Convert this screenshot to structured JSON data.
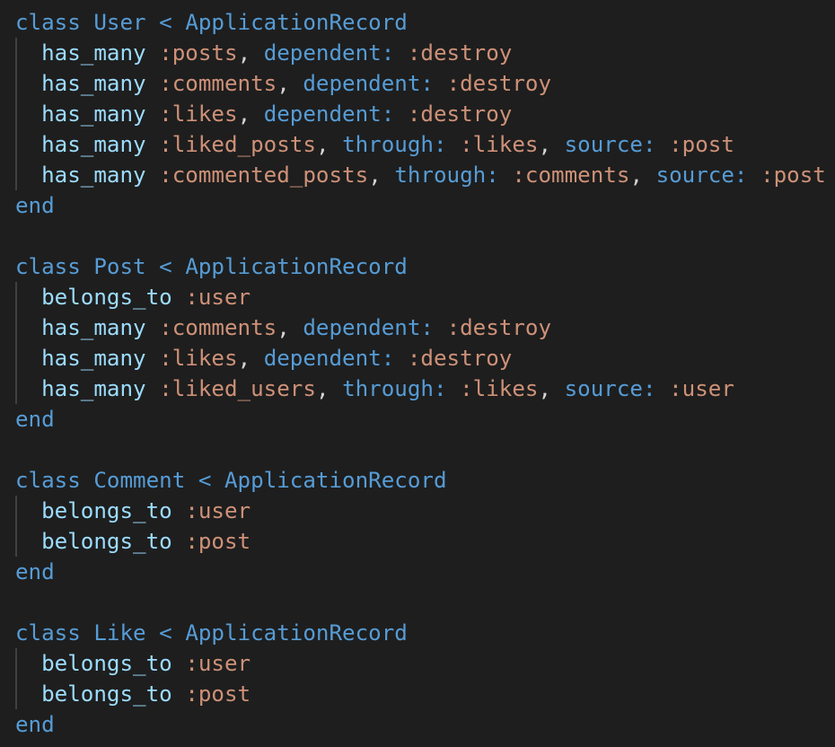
{
  "colors": {
    "background": "#1e1e1e",
    "keyword": "#569cd6",
    "constant": "#4ec9b0",
    "symbol": "#ce9178",
    "method": "#9cdcfe",
    "plain": "#d4d4d4",
    "indent_guide": "#404040"
  },
  "code": {
    "lines": [
      [
        {
          "t": "class",
          "c": "keyword"
        },
        {
          "t": " ",
          "c": "plain"
        },
        {
          "t": "User",
          "c": "keyword"
        },
        {
          "t": " < ",
          "c": "keyword"
        },
        {
          "t": "ApplicationRecord",
          "c": "keyword"
        }
      ],
      [
        {
          "t": "  ",
          "c": "plain"
        },
        {
          "t": "has_many",
          "c": "method"
        },
        {
          "t": " ",
          "c": "plain"
        },
        {
          "t": ":posts",
          "c": "symbol"
        },
        {
          "t": ", ",
          "c": "plain"
        },
        {
          "t": "dependent:",
          "c": "keyword"
        },
        {
          "t": " ",
          "c": "plain"
        },
        {
          "t": ":destroy",
          "c": "symbol"
        }
      ],
      [
        {
          "t": "  ",
          "c": "plain"
        },
        {
          "t": "has_many",
          "c": "method"
        },
        {
          "t": " ",
          "c": "plain"
        },
        {
          "t": ":comments",
          "c": "symbol"
        },
        {
          "t": ", ",
          "c": "plain"
        },
        {
          "t": "dependent:",
          "c": "keyword"
        },
        {
          "t": " ",
          "c": "plain"
        },
        {
          "t": ":destroy",
          "c": "symbol"
        }
      ],
      [
        {
          "t": "  ",
          "c": "plain"
        },
        {
          "t": "has_many",
          "c": "method"
        },
        {
          "t": " ",
          "c": "plain"
        },
        {
          "t": ":likes",
          "c": "symbol"
        },
        {
          "t": ", ",
          "c": "plain"
        },
        {
          "t": "dependent:",
          "c": "keyword"
        },
        {
          "t": " ",
          "c": "plain"
        },
        {
          "t": ":destroy",
          "c": "symbol"
        }
      ],
      [
        {
          "t": "  ",
          "c": "plain"
        },
        {
          "t": "has_many",
          "c": "method"
        },
        {
          "t": " ",
          "c": "plain"
        },
        {
          "t": ":liked_posts",
          "c": "symbol"
        },
        {
          "t": ", ",
          "c": "plain"
        },
        {
          "t": "through:",
          "c": "keyword"
        },
        {
          "t": " ",
          "c": "plain"
        },
        {
          "t": ":likes",
          "c": "symbol"
        },
        {
          "t": ", ",
          "c": "plain"
        },
        {
          "t": "source:",
          "c": "keyword"
        },
        {
          "t": " ",
          "c": "plain"
        },
        {
          "t": ":post",
          "c": "symbol"
        }
      ],
      [
        {
          "t": "  ",
          "c": "plain"
        },
        {
          "t": "has_many",
          "c": "method"
        },
        {
          "t": " ",
          "c": "plain"
        },
        {
          "t": ":commented_posts",
          "c": "symbol"
        },
        {
          "t": ", ",
          "c": "plain"
        },
        {
          "t": "through:",
          "c": "keyword"
        },
        {
          "t": " ",
          "c": "plain"
        },
        {
          "t": ":comments",
          "c": "symbol"
        },
        {
          "t": ", ",
          "c": "plain"
        },
        {
          "t": "source:",
          "c": "keyword"
        },
        {
          "t": " ",
          "c": "plain"
        },
        {
          "t": ":post",
          "c": "symbol"
        }
      ],
      [
        {
          "t": "end",
          "c": "keyword"
        }
      ],
      [],
      [
        {
          "t": "class",
          "c": "keyword"
        },
        {
          "t": " ",
          "c": "plain"
        },
        {
          "t": "Post",
          "c": "keyword"
        },
        {
          "t": " < ",
          "c": "keyword"
        },
        {
          "t": "ApplicationRecord",
          "c": "keyword"
        }
      ],
      [
        {
          "t": "  ",
          "c": "plain"
        },
        {
          "t": "belongs_to",
          "c": "method"
        },
        {
          "t": " ",
          "c": "plain"
        },
        {
          "t": ":user",
          "c": "symbol"
        }
      ],
      [
        {
          "t": "  ",
          "c": "plain"
        },
        {
          "t": "has_many",
          "c": "method"
        },
        {
          "t": " ",
          "c": "plain"
        },
        {
          "t": ":comments",
          "c": "symbol"
        },
        {
          "t": ", ",
          "c": "plain"
        },
        {
          "t": "dependent:",
          "c": "keyword"
        },
        {
          "t": " ",
          "c": "plain"
        },
        {
          "t": ":destroy",
          "c": "symbol"
        }
      ],
      [
        {
          "t": "  ",
          "c": "plain"
        },
        {
          "t": "has_many",
          "c": "method"
        },
        {
          "t": " ",
          "c": "plain"
        },
        {
          "t": ":likes",
          "c": "symbol"
        },
        {
          "t": ", ",
          "c": "plain"
        },
        {
          "t": "dependent:",
          "c": "keyword"
        },
        {
          "t": " ",
          "c": "plain"
        },
        {
          "t": ":destroy",
          "c": "symbol"
        }
      ],
      [
        {
          "t": "  ",
          "c": "plain"
        },
        {
          "t": "has_many",
          "c": "method"
        },
        {
          "t": " ",
          "c": "plain"
        },
        {
          "t": ":liked_users",
          "c": "symbol"
        },
        {
          "t": ", ",
          "c": "plain"
        },
        {
          "t": "through:",
          "c": "keyword"
        },
        {
          "t": " ",
          "c": "plain"
        },
        {
          "t": ":likes",
          "c": "symbol"
        },
        {
          "t": ", ",
          "c": "plain"
        },
        {
          "t": "source:",
          "c": "keyword"
        },
        {
          "t": " ",
          "c": "plain"
        },
        {
          "t": ":user",
          "c": "symbol"
        }
      ],
      [
        {
          "t": "end",
          "c": "keyword"
        }
      ],
      [],
      [
        {
          "t": "class",
          "c": "keyword"
        },
        {
          "t": " ",
          "c": "plain"
        },
        {
          "t": "Comment",
          "c": "keyword"
        },
        {
          "t": " < ",
          "c": "keyword"
        },
        {
          "t": "ApplicationRecord",
          "c": "keyword"
        }
      ],
      [
        {
          "t": "  ",
          "c": "plain"
        },
        {
          "t": "belongs_to",
          "c": "method"
        },
        {
          "t": " ",
          "c": "plain"
        },
        {
          "t": ":user",
          "c": "symbol"
        }
      ],
      [
        {
          "t": "  ",
          "c": "plain"
        },
        {
          "t": "belongs_to",
          "c": "method"
        },
        {
          "t": " ",
          "c": "plain"
        },
        {
          "t": ":post",
          "c": "symbol"
        }
      ],
      [
        {
          "t": "end",
          "c": "keyword"
        }
      ],
      [],
      [
        {
          "t": "class",
          "c": "keyword"
        },
        {
          "t": " ",
          "c": "plain"
        },
        {
          "t": "Like",
          "c": "keyword"
        },
        {
          "t": " < ",
          "c": "keyword"
        },
        {
          "t": "ApplicationRecord",
          "c": "keyword"
        }
      ],
      [
        {
          "t": "  ",
          "c": "plain"
        },
        {
          "t": "belongs_to",
          "c": "method"
        },
        {
          "t": " ",
          "c": "plain"
        },
        {
          "t": ":user",
          "c": "symbol"
        }
      ],
      [
        {
          "t": "  ",
          "c": "plain"
        },
        {
          "t": "belongs_to",
          "c": "method"
        },
        {
          "t": " ",
          "c": "plain"
        },
        {
          "t": ":post",
          "c": "symbol"
        }
      ],
      [
        {
          "t": "end",
          "c": "keyword"
        }
      ]
    ],
    "indent_guides": [
      {
        "from": 1,
        "to": 5
      },
      {
        "from": 9,
        "to": 12
      },
      {
        "from": 16,
        "to": 17
      },
      {
        "from": 21,
        "to": 22
      }
    ]
  }
}
